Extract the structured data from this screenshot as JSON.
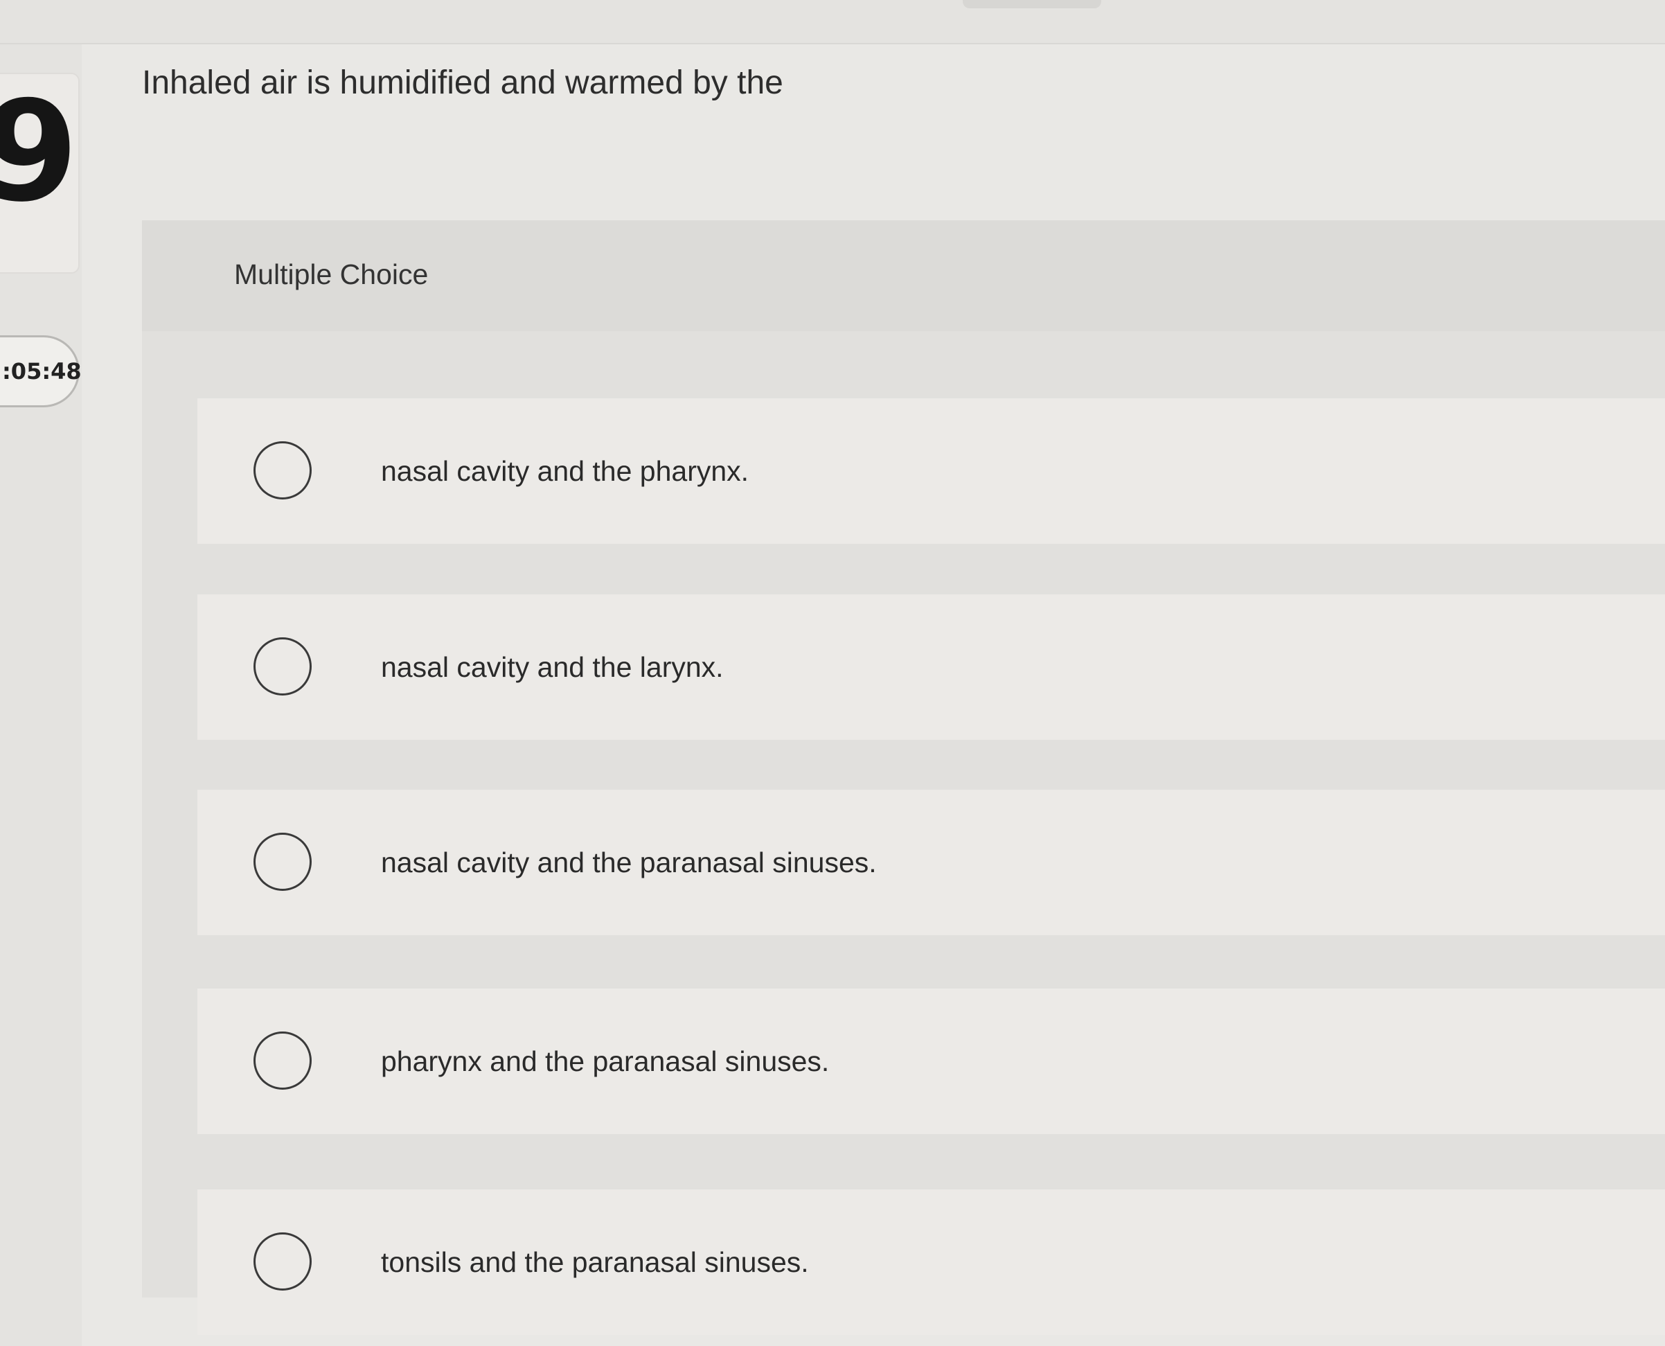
{
  "question": {
    "number": "9",
    "timer": ":05:48",
    "prompt": "Inhaled air is humidified and warmed by the",
    "type_label": "Multiple Choice"
  },
  "options": [
    {
      "label": "nasal cavity and the pharynx."
    },
    {
      "label": "nasal cavity and the larynx."
    },
    {
      "label": "nasal cavity and the paranasal sinuses."
    },
    {
      "label": "pharynx and the paranasal sinuses."
    },
    {
      "label": "tonsils and the paranasal sinuses."
    }
  ],
  "colors": {
    "page_background": "#e9e8e5",
    "panel_background": "#e1e0dd",
    "option_background": "#eceae7",
    "text": "#2b2b2b"
  }
}
